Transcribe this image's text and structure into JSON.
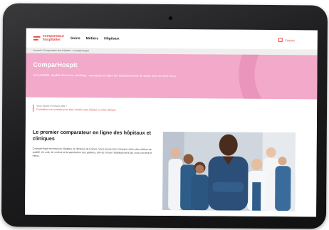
{
  "logo": {
    "line1": "comparateur",
    "line2": "hospitalier"
  },
  "nav": {
    "items": [
      "Soins",
      "Métiers",
      "Hôpitaux"
    ]
  },
  "header": {
    "contact_label": "Contact"
  },
  "breadcrumb": {
    "text": "Accueil > Comparateur des hôpitaux > ComparHospit"
  },
  "hero": {
    "title": "ComparHospit",
    "description": "Accessibilité, qualité des soins, résultats : comparez en ligne les établissements de santé près de chez vous."
  },
  "info": {
    "line1": "Vous voulez en savoir plus ?",
    "line2": "Consultez nos conseils pour bien choisir votre hôpital ou votre clinique"
  },
  "section": {
    "title": "Le premier comparateur en ligne des hôpitaux et cliniques",
    "body": "ComparHospit recense les hôpitaux et cliniques de France. Vous pouvez les comparer selon des critères de qualité, de coût, de confort et de satisfaction des patients, afin de choisir l'établissement qui vous convient le mieux."
  },
  "colors": {
    "brand": "#e9443f",
    "hero": "#f2a9ca",
    "hero_deco": "#e58fb7",
    "bezel": "#1d1d1f"
  },
  "icons": {
    "contact": "phone-icon",
    "photo": "medical-team-photo"
  }
}
